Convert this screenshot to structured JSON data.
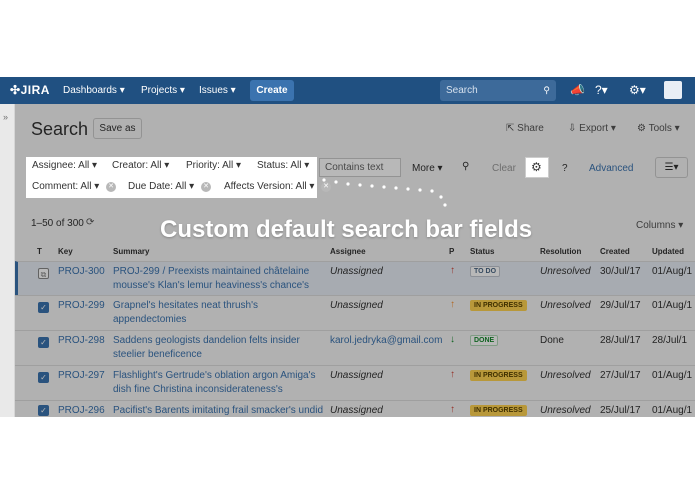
{
  "topnav": {
    "logo": "JIRA",
    "items": [
      "Dashboards ▾",
      "Projects ▾",
      "Issues ▾"
    ],
    "create": "Create",
    "search_placeholder": "Search"
  },
  "header": {
    "title": "Search",
    "save_as": "Save as",
    "share": "Share",
    "export": "Export ▾",
    "tools": "Tools ▾"
  },
  "filters": {
    "chips": [
      "Assignee: All ▾",
      "Creator: All ▾",
      "Priority: All ▾",
      "Status: All ▾",
      "Comment: All ▾",
      "Due Date: All ▾",
      "Affects Version: All ▾"
    ],
    "contains_placeholder": "Contains text",
    "more": "More ▾",
    "clear": "Clear",
    "advanced": "Advanced"
  },
  "callout": "Custom default search bar fields",
  "results": {
    "count": "1–50 of 300",
    "columns": "Columns ▾",
    "headers": [
      "T",
      "Key",
      "Summary",
      "Assignee",
      "P",
      "Status",
      "Resolution",
      "Created",
      "Updated"
    ],
    "rows": [
      {
        "key": "PROJ-300",
        "summary": "PROJ-299 / Preexists maintained châtelaine mousse's Klan's lemur heaviness's chance's",
        "assignee": "Unassigned",
        "priority": "↑",
        "status": "TO DO",
        "resolution": "Unresolved",
        "created": "30/Jul/17",
        "updated": "01/Aug/1"
      },
      {
        "key": "PROJ-299",
        "summary": "Grapnel's hesitates neat thrush's appendectomies",
        "assignee": "Unassigned",
        "priority": "↑",
        "status": "IN PROGRESS",
        "resolution": "Unresolved",
        "created": "29/Jul/17",
        "updated": "01/Aug/1"
      },
      {
        "key": "PROJ-298",
        "summary": "Saddens geologists dandelion felts insider steelier beneficence",
        "assignee": "karol.jedryka@gmail.com",
        "priority": "↓",
        "status": "DONE",
        "resolution": "Done",
        "created": "28/Jul/17",
        "updated": "28/Jul/1"
      },
      {
        "key": "PROJ-297",
        "summary": "Flashlight's Gertrude's oblation argon Amiga's dish fine Christina inconsiderateness's",
        "assignee": "Unassigned",
        "priority": "↑",
        "status": "IN PROGRESS",
        "resolution": "Unresolved",
        "created": "27/Jul/17",
        "updated": "01/Aug/1"
      },
      {
        "key": "PROJ-296",
        "summary": "Pacifist's Barents imitating frail smacker's undid",
        "assignee": "Unassigned",
        "priority": "↑",
        "status": "IN PROGRESS",
        "resolution": "Unresolved",
        "created": "25/Jul/17",
        "updated": "01/Aug/1"
      }
    ]
  },
  "colors": {
    "nav": "#205081",
    "link": "#3b73af",
    "priority_up": "#d04437",
    "priority_down": "#14892c"
  }
}
